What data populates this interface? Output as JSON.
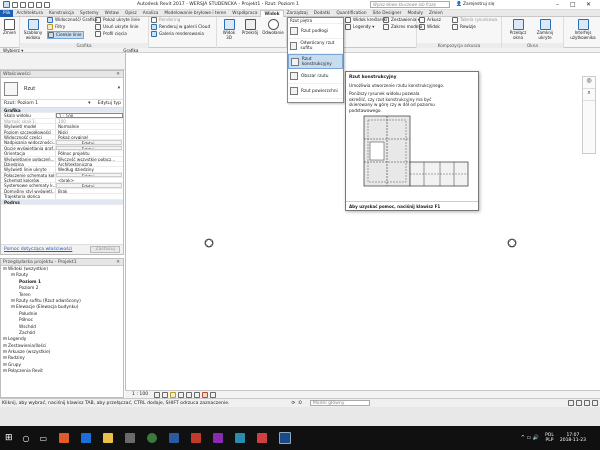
{
  "titlebar": {
    "title": "Autodesk Revit 2017 - WERSJA STUDENCKA -   Projekt1 - Rzut: Poziom 1",
    "search_placeholder": "Wpisz słowo kluczowe lub frazę",
    "user": "Zarejestruj się"
  },
  "tabs": [
    "Plik",
    "Architektura",
    "Konstrukcja",
    "Systemy",
    "Wstaw",
    "Opisz",
    "Analiza",
    "Modelowanie bryłowe i teren",
    "Współpraca",
    "Widok",
    "Zarządzaj",
    "Dodatki",
    "Quantification",
    "Site Designer",
    "Moduły",
    "Zmień"
  ],
  "active_tab": "Widok",
  "ribbon": {
    "modify": "Zmień",
    "select": "Wybierz",
    "graphics_items": [
      "Widoczność/ Grafika",
      "Filtry",
      "Cienkie linie",
      "Pokaż ukryte linie",
      "Usuń ukryte linie",
      "Profil cięcia",
      "Rendering",
      "Renderuj w galerii Cloud",
      "Galeria renderowania"
    ],
    "graphics_label": "Grafika",
    "view_templates": "Szablony widoku",
    "view3d": "Widok 3D",
    "section": "Przekrój",
    "callout": "Odwołanie",
    "plan_views": "Widoki planu",
    "drafting": "Widok kreślarski",
    "legends": "Legendy",
    "schedules": "Zestawienia",
    "scope_box": "Zakres modelu",
    "sheet": "Arkusz",
    "title_block": "Tabela rysunkowa",
    "revisions": "Rewizje",
    "view_ref": "Widok",
    "sheet_comp_label": "Kompozycja arkusza",
    "switch_windows": "Przełącz okna",
    "close_hidden": "Zamknij ukryte",
    "window_label": "Okna",
    "user_interface": "Interfejs użytkownika"
  },
  "qat": {
    "select_label": "Wybierz ▾",
    "graphics_label": "Grafika"
  },
  "properties": {
    "title": "Właściwości",
    "type_name": "Rzut",
    "instance": "Rzut: Poziom 1",
    "edit_type": "Edytuj typ",
    "group": "Grafika",
    "rows": [
      {
        "k": "Skala widoku",
        "v": "1 : 100"
      },
      {
        "k": "Wartość skali 1:",
        "v": "100",
        "dim": true
      },
      {
        "k": "Wyświetl model",
        "v": "Normalnie"
      },
      {
        "k": "Poziom szczegółowości",
        "v": "Niski"
      },
      {
        "k": "Widoczność części",
        "v": "Pokaż oryginał"
      },
      {
        "k": "Nadpisania widoczności...",
        "v": "Edytuj..."
      },
      {
        "k": "Opcje wyświetlania graf...",
        "v": "Edytuj..."
      },
      {
        "k": "Orientacja",
        "v": "Północ projektu"
      },
      {
        "k": "Wyświetlanie połączeń...",
        "v": "Wyczyść wszystkie połącz..."
      },
      {
        "k": "Dziedzina",
        "v": "Architektoniczna"
      },
      {
        "k": "Wyświetl linie ukryte",
        "v": "Według dziedziny"
      },
      {
        "k": "Połączenie schematu koł...",
        "v": "Edytuj..."
      },
      {
        "k": "Schemat kolorów",
        "v": "<brak>"
      },
      {
        "k": "Systemowe schematy k...",
        "v": "Edytuj..."
      },
      {
        "k": "Domyślny styl wyświetl...",
        "v": "Brak"
      },
      {
        "k": "Trajektoria słońca",
        "v": ""
      }
    ],
    "group2": "Podrys",
    "link": "Pomoc dotycząca właściwości",
    "apply": "Zastosuj"
  },
  "browser": {
    "title": "Przeglądarka projektu - Projekt1",
    "tree": [
      {
        "t": "Widoki (wszystkie)",
        "lvl": 0
      },
      {
        "t": "Rzuty",
        "lvl": 1
      },
      {
        "t": "Poziom 1",
        "lvl": 2,
        "bold": true
      },
      {
        "t": "Poziom 2",
        "lvl": 2
      },
      {
        "t": "Teren",
        "lvl": 2
      },
      {
        "t": "Rzuty sufitu (Rzut odwrócony)",
        "lvl": 1
      },
      {
        "t": "Elewacje (Elewacja budynku)",
        "lvl": 1
      },
      {
        "t": "Południe",
        "lvl": 2
      },
      {
        "t": "Północ",
        "lvl": 2
      },
      {
        "t": "Wschód",
        "lvl": 2
      },
      {
        "t": "Zachód",
        "lvl": 2
      },
      {
        "t": "Legendy",
        "lvl": 0
      },
      {
        "t": "Zestawienia/Ilości",
        "lvl": 0
      },
      {
        "t": "Arkusze (wszystkie)",
        "lvl": 0
      },
      {
        "t": "Rodziny",
        "lvl": 0
      },
      {
        "t": "Grupy",
        "lvl": 0
      },
      {
        "t": "Połączenia Revit",
        "lvl": 0
      }
    ]
  },
  "dropdown": [
    "Rzut piętra",
    "Rzut podłogi",
    "Odwrócony rzut sufitu",
    "Rzut konstrukcyjny",
    "Obszar rzutu",
    "Rzut powierzchni"
  ],
  "tooltip": {
    "title": "Rzut konstrukcyjny",
    "subtitle": "Umożliwia utworzenie rzutu konstrukcyjnego.",
    "body": "Poniższy rysunek widoku pozwala określić, czy rzut konstrukcyjny ma być skierowany w górę czy w dół od poziomu podstawowego.",
    "help": "Aby uzyskać pomoc, naciśnij klawisz F1"
  },
  "viewctrl": {
    "scale": "1 : 100"
  },
  "status": {
    "text": "Kliknij, aby wybrać, naciśnij klawisz TAB, aby przełączać, CTRL dodaje, SHIFT odrzuca zaznaczenie.",
    "model": "Model główny",
    "zero": ":0"
  },
  "taskbar": {
    "lang": "POL",
    "locale": "PLP",
    "time": "17:07",
    "date": "2018-11-23"
  }
}
